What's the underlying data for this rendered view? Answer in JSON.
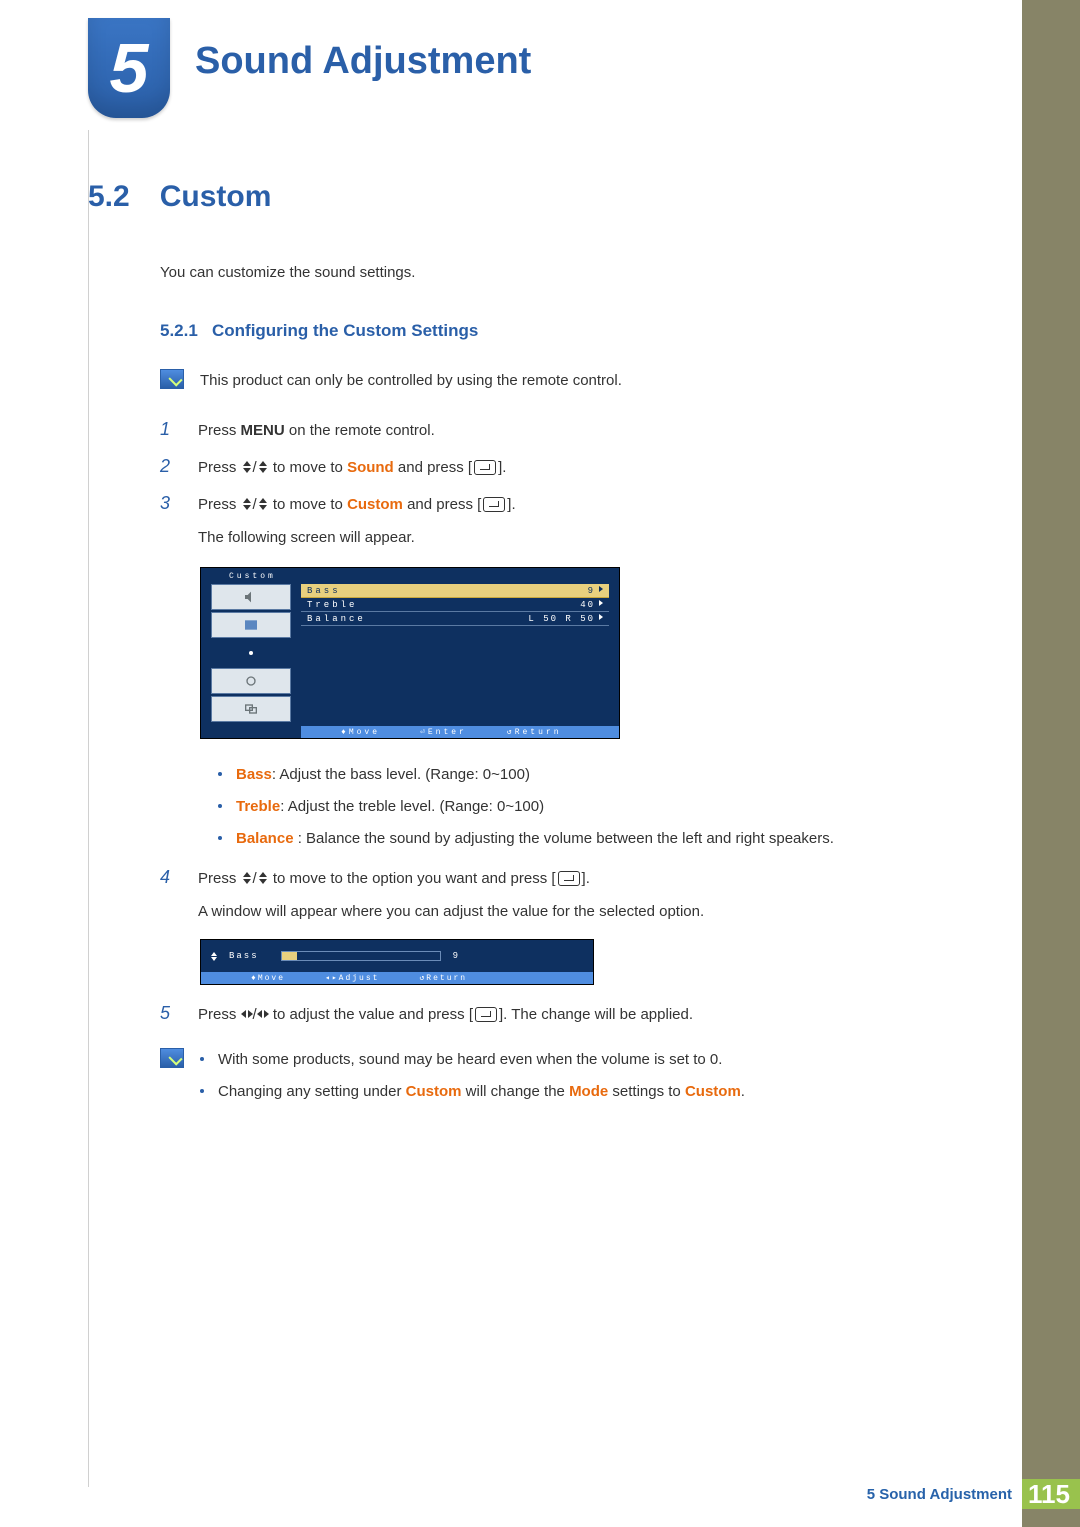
{
  "chapter": {
    "number": "5",
    "title": "Sound Adjustment"
  },
  "section": {
    "number": "5.2",
    "title": "Custom",
    "intro": "You can customize the sound settings."
  },
  "subsection": {
    "number": "5.2.1",
    "title": "Configuring the Custom Settings"
  },
  "note_top": "This product can only be controlled by using the remote control.",
  "steps": {
    "s1": {
      "num": "1",
      "pre": "Press ",
      "menu": "MENU",
      "post": " on the remote control."
    },
    "s2": {
      "num": "2",
      "pre": "Press ",
      "mid": " to move to ",
      "target": "Sound",
      "post": " and press [",
      "end": "]."
    },
    "s3": {
      "num": "3",
      "pre": "Press ",
      "mid": " to move to ",
      "target": "Custom",
      "post": " and press [",
      "end": "].",
      "after": "The following screen will appear."
    },
    "s4": {
      "num": "4",
      "pre": "Press ",
      "mid": " to move to the option you want and press [",
      "end": "].",
      "after": "A window will appear where you can adjust the value for the selected option."
    },
    "s5": {
      "num": "5",
      "pre": "Press ",
      "mid": " to adjust the value and press [",
      "end": "]. The change will be applied."
    }
  },
  "osd": {
    "title": "Custom",
    "rows": [
      {
        "label": "Bass",
        "value": "9"
      },
      {
        "label": "Treble",
        "value": "40"
      },
      {
        "label": "Balance",
        "value": "L 50  R 50"
      }
    ],
    "footer": {
      "move": "Move",
      "enter": "Enter",
      "return": "Return"
    }
  },
  "bullets": {
    "bass": {
      "name": "Bass",
      "desc": ": Adjust the bass level. (Range: 0~100)"
    },
    "treble": {
      "name": "Treble",
      "desc": ": Adjust the treble level. (Range: 0~100)"
    },
    "balance": {
      "name": "Balance",
      "desc": " : Balance the sound by adjusting the volume between the left and right speakers."
    }
  },
  "adjust": {
    "label": "Bass",
    "value": "9",
    "footer": {
      "move": "Move",
      "adjust": "Adjust",
      "return": "Return"
    }
  },
  "notes_bottom": {
    "n1": "With some products, sound may be heard even when the volume is set to 0.",
    "n2_a": "Changing any setting under ",
    "n2_b": "Custom",
    "n2_c": " will change the ",
    "n2_d": "Mode",
    "n2_e": " settings to ",
    "n2_f": "Custom",
    "n2_g": "."
  },
  "footer": {
    "label": "5 Sound Adjustment",
    "page": "115"
  }
}
